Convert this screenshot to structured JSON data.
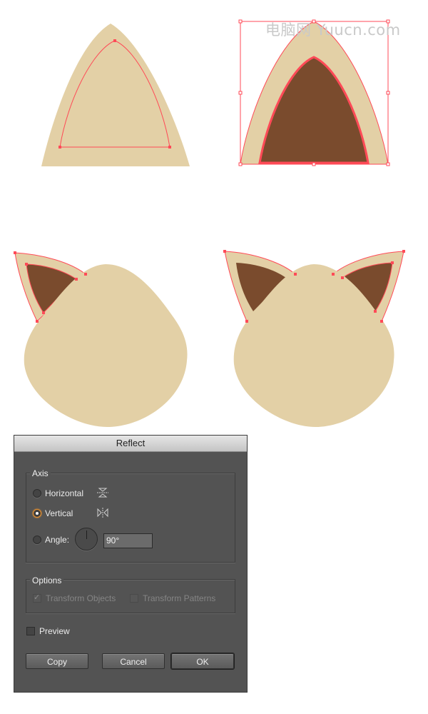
{
  "watermark": "电脑网 Yuucn.com",
  "colors": {
    "ear_base": "#e3d0a6",
    "ear_inner": "#7a4b2d",
    "selection": "#ff4a57",
    "dialog_bg": "#535353",
    "radio_active": "#e6902f"
  },
  "dialog": {
    "title": "Reflect",
    "axis": {
      "legend": "Axis",
      "horizontal_label": "Horizontal",
      "vertical_label": "Vertical",
      "angle_label": "Angle:",
      "angle_value": "90°",
      "selected": "vertical"
    },
    "options": {
      "legend": "Options",
      "transform_objects_label": "Transform Objects",
      "transform_objects_checked": true,
      "transform_patterns_label": "Transform Patterns",
      "transform_patterns_checked": false
    },
    "preview_label": "Preview",
    "preview_checked": false,
    "buttons": {
      "copy": "Copy",
      "cancel": "Cancel",
      "ok": "OK"
    }
  }
}
